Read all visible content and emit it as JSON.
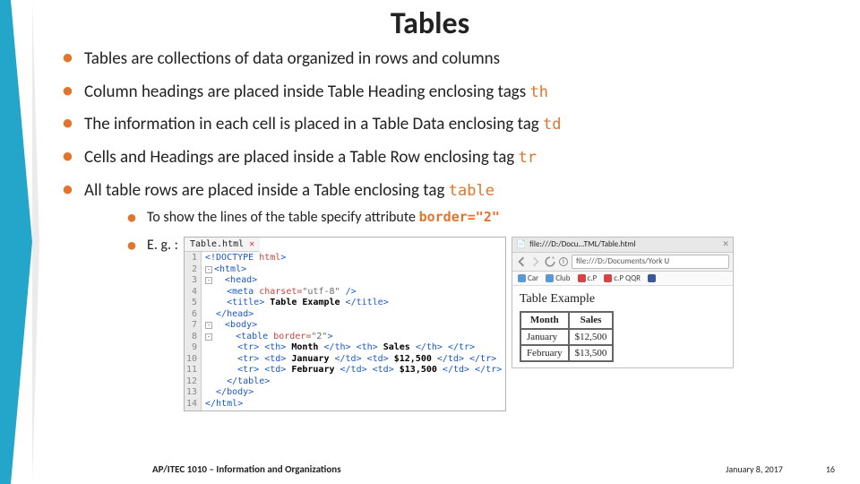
{
  "title": "Tables",
  "bullets": [
    {
      "text": "Tables are collections of data organized in rows and columns",
      "code": ""
    },
    {
      "text": "Column headings are placed inside Table Heading enclosing tags ",
      "code": "th"
    },
    {
      "text": "The information in each cell is placed in a Table Data enclosing tag ",
      "code": "td"
    },
    {
      "text": "Cells and Headings are placed inside a Table Row enclosing tag ",
      "code": "tr"
    },
    {
      "text": "All table rows are placed inside a Table enclosing tag ",
      "code": "table"
    }
  ],
  "sub": {
    "line1_text": "To show the lines of the table specify attribute ",
    "line1_code": "border=\"2\"",
    "line2_text": "E. g. :"
  },
  "editor": {
    "tab": "Table.html",
    "lines": [
      "<!DOCTYPE html>",
      "<html>",
      "  <head>",
      "    <meta charset=\"utf-8\" />",
      "    <title> Table Example </title>",
      "  </head>",
      "  <body>",
      "    <table border=\"2\">",
      "      <tr> <th> Month </th> <th> Sales </th> </tr>",
      "      <tr> <td> January </td> <td> $12,500 </td> </tr>",
      "      <tr> <td> February </td> <td> $13,500 </td> </tr>",
      "    </table>",
      "  </body>",
      "</html>"
    ]
  },
  "browser": {
    "tab": "file:///D:/Docu...TML/Table.html",
    "url": "file:///D:/Documents/York U",
    "bookmarks": [
      "Car",
      "Club",
      "c.P",
      "c.P QQR"
    ],
    "heading": "Table Example",
    "table": {
      "headers": [
        "Month",
        "Sales"
      ],
      "rows": [
        [
          "January",
          "$12,500"
        ],
        [
          "February",
          "$13,500"
        ]
      ]
    }
  },
  "footer": {
    "course": "AP/ITEC 1010 – Information and Organizations",
    "date": "January 8, 2017",
    "page": "16"
  }
}
